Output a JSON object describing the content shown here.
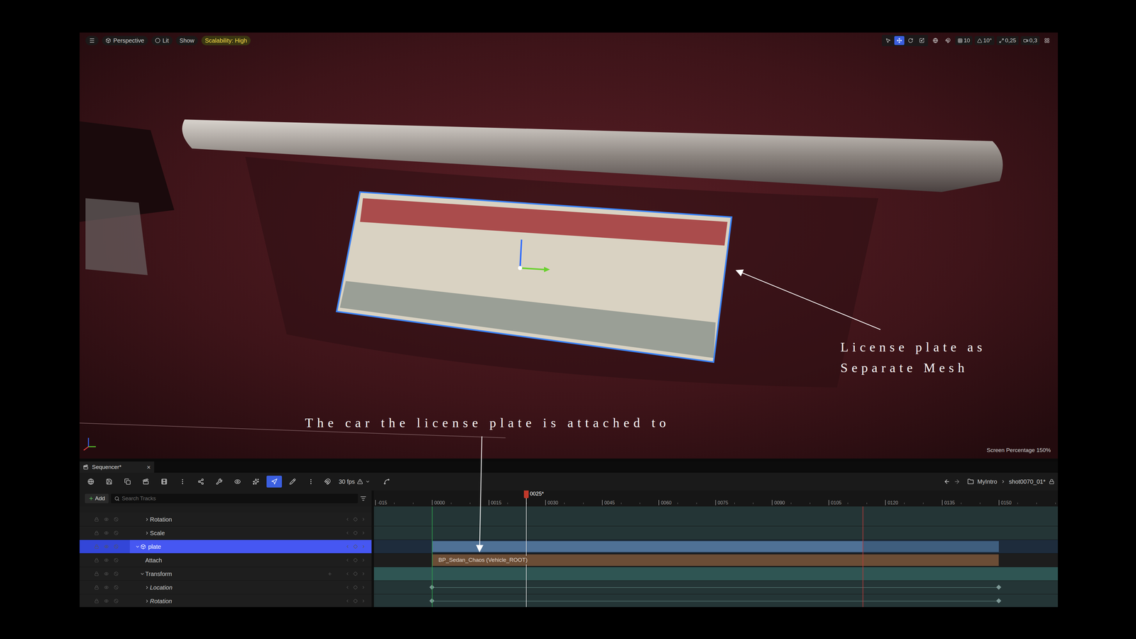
{
  "viewport": {
    "view_mode": "Perspective",
    "lighting": "Lit",
    "show": "Show",
    "scalability": "Scalability: High",
    "transform_tools": [
      {
        "selected": false
      },
      {
        "selected": true
      },
      {
        "selected": false
      },
      {
        "selected": false
      }
    ],
    "snaps": [
      {
        "value": "10"
      },
      {
        "value": "10°"
      },
      {
        "value": "0,25"
      },
      {
        "value": "0,3"
      }
    ],
    "screen_percentage": "Screen Percentage 150%"
  },
  "annotations": [
    {
      "lines": [
        "License plate as",
        "Separate Mesh"
      ]
    },
    {
      "lines": [
        "The car the license plate is attached to"
      ]
    }
  ],
  "sequencer": {
    "tab": {
      "label": "Sequencer*",
      "close": "×"
    },
    "toolbar_buttons": [
      {
        "selected": false
      },
      {
        "selected": false
      },
      {
        "selected": false
      },
      {
        "selected": false
      },
      {
        "selected": false
      },
      {
        "selected": false
      },
      {
        "selected": false
      },
      {
        "selected": false
      },
      {
        "selected": false
      },
      {
        "selected": false
      },
      {
        "selected": true
      },
      {
        "selected": false
      },
      {
        "selected": false
      }
    ],
    "frame_rate": "30 fps",
    "breadcrumbs": [
      "MyIntro",
      "shot0070_01*"
    ],
    "add": "Add",
    "search_placeholder": "Search Tracks",
    "ruler": [
      "-015",
      "0000",
      "0015",
      "0030",
      "0045",
      "0060",
      "0075",
      "0090",
      "0105",
      "0120",
      "0135",
      "0150"
    ],
    "playhead": "0025*",
    "tracks": [
      {
        "label": "Rotation",
        "depth": 2,
        "kind": "channel",
        "expandable": true,
        "expanded": false,
        "selected": false,
        "italic": false,
        "keys": false
      },
      {
        "label": "Scale",
        "depth": 2,
        "kind": "channel",
        "expandable": true,
        "expanded": false,
        "selected": false,
        "italic": false,
        "keys": false
      },
      {
        "label": "plate",
        "depth": 0,
        "kind": "actor",
        "expandable": true,
        "expanded": true,
        "selected": true,
        "italic": false,
        "keys": false
      },
      {
        "label": "Attach",
        "depth": 1,
        "kind": "attach",
        "expandable": false,
        "expanded": false,
        "selected": false,
        "italic": false,
        "keys": false,
        "section": "BP_Sedan_Chaos (Vehicle_ROOT)"
      },
      {
        "label": "Transform",
        "depth": 1,
        "kind": "transform",
        "expandable": true,
        "expanded": true,
        "selected": false,
        "italic": false,
        "keys": false
      },
      {
        "label": "Location",
        "depth": 2,
        "kind": "channel",
        "expandable": true,
        "expanded": false,
        "selected": false,
        "italic": true,
        "keys": true
      },
      {
        "label": "Rotation",
        "depth": 2,
        "kind": "channel",
        "expandable": true,
        "expanded": false,
        "selected": false,
        "italic": true,
        "keys": true
      }
    ]
  }
}
